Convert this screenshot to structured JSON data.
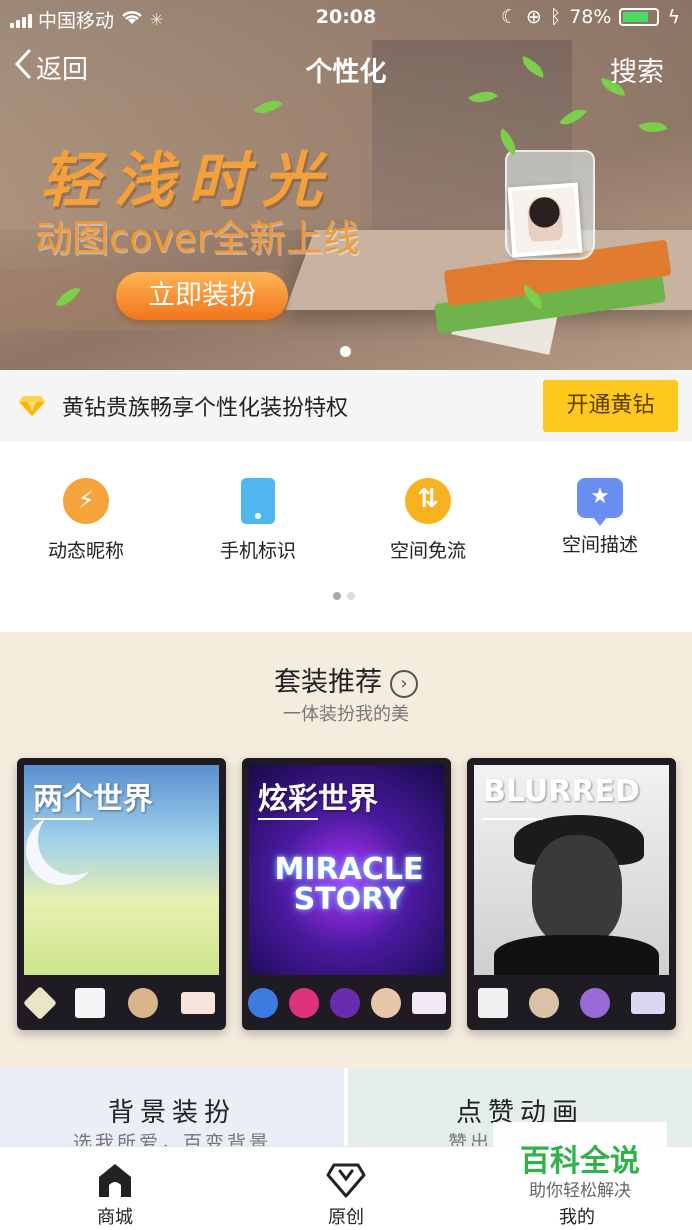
{
  "status_bar": {
    "carrier": "中国移动",
    "time": "20:08",
    "battery_percent": "78%",
    "battery_level": 0.78,
    "icons": [
      "signal-icon",
      "wifi-icon",
      "loading-icon",
      "moon-icon",
      "orientation-lock-icon",
      "bluetooth-icon",
      "battery-icon",
      "charging-icon"
    ]
  },
  "nav": {
    "back_label": "返回",
    "title": "个性化",
    "search_label": "搜索"
  },
  "banner": {
    "headline": "轻浅时光",
    "subheadline": "动图cover全新上线",
    "cta_label": "立即装扮"
  },
  "vip": {
    "text": "黄钻贵族畅享个性化装扮特权",
    "button_label": "开通黄钻",
    "accent": "#ffc81e"
  },
  "features": [
    {
      "label": "动态昵称",
      "icon": "lightning-icon",
      "color": "#f5a33a"
    },
    {
      "label": "手机标识",
      "icon": "phone-icon",
      "color": "#4fb6f0"
    },
    {
      "label": "空间免流",
      "icon": "data-flow-icon",
      "color": "#f7b21f"
    },
    {
      "label": "空间描述",
      "icon": "star-bubble-icon",
      "color": "#6a8ef0"
    }
  ],
  "suits": {
    "title": "套装推荐",
    "subtitle": "一体装扮我的美",
    "cards": [
      {
        "name": "两个世界"
      },
      {
        "name": "炫彩世界",
        "art_text": "MIRACLE STORY"
      },
      {
        "name": "BLURRED"
      }
    ]
  },
  "categories": [
    {
      "title": "背景装扮",
      "subtitle": "选我所爱，百变背景"
    },
    {
      "title": "点赞动画",
      "subtitle": "赞出"
    }
  ],
  "tabbar": [
    {
      "label": "商城",
      "icon": "home-icon"
    },
    {
      "label": "原创",
      "icon": "pentagon-icon"
    },
    {
      "label": "我的",
      "icon": "user-icon"
    }
  ],
  "watermark": {
    "title": "百科全说",
    "subtitle": "助你轻松解决"
  }
}
